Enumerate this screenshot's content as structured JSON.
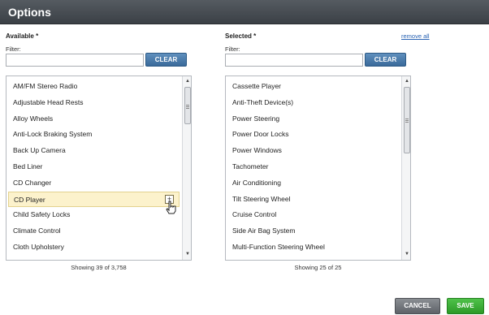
{
  "header": {
    "title": "Options"
  },
  "available": {
    "label": "Available",
    "required_marker": "*",
    "filter_label": "Filter:",
    "filter_value": "",
    "clear_label": "CLEAR",
    "items": [
      "AM/FM Stereo Radio",
      "Adjustable Head Rests",
      "Alloy Wheels",
      "Anti-Lock Braking System",
      "Back Up Camera",
      "Bed Liner",
      "CD Changer",
      "CD Player",
      "Child Safety Locks",
      "Climate Control",
      "Cloth Upholstery"
    ],
    "selected_item": "CD Player",
    "add_symbol": "+",
    "showing_text": "Showing 39 of 3,758"
  },
  "selected": {
    "label": "Selected",
    "required_marker": "*",
    "remove_all_label": "remove all",
    "filter_label": "Filter:",
    "filter_value": "",
    "clear_label": "CLEAR",
    "items": [
      "Cassette Player",
      "Anti-Theft Device(s)",
      "Power Steering",
      "Power Door Locks",
      "Power Windows",
      "Tachometer",
      "Air Conditioning",
      "Tilt Steering Wheel",
      "Cruise Control",
      "Side Air Bag System",
      "Multi-Function Steering Wheel"
    ],
    "showing_text": "Showing 25 of 25"
  },
  "footer": {
    "cancel_label": "CANCEL",
    "save_label": "SAVE"
  },
  "colors": {
    "header_bg": "#3b4046",
    "clear_bg": "#3a6a9a",
    "save_bg": "#2c9a27",
    "cancel_bg": "#5e6268",
    "highlight_bg": "#fcf2cc"
  },
  "icons": {
    "scroll_up": "scroll-up-icon",
    "scroll_down": "scroll-down-icon",
    "add": "plus-icon",
    "cursor": "hand-cursor-icon"
  }
}
